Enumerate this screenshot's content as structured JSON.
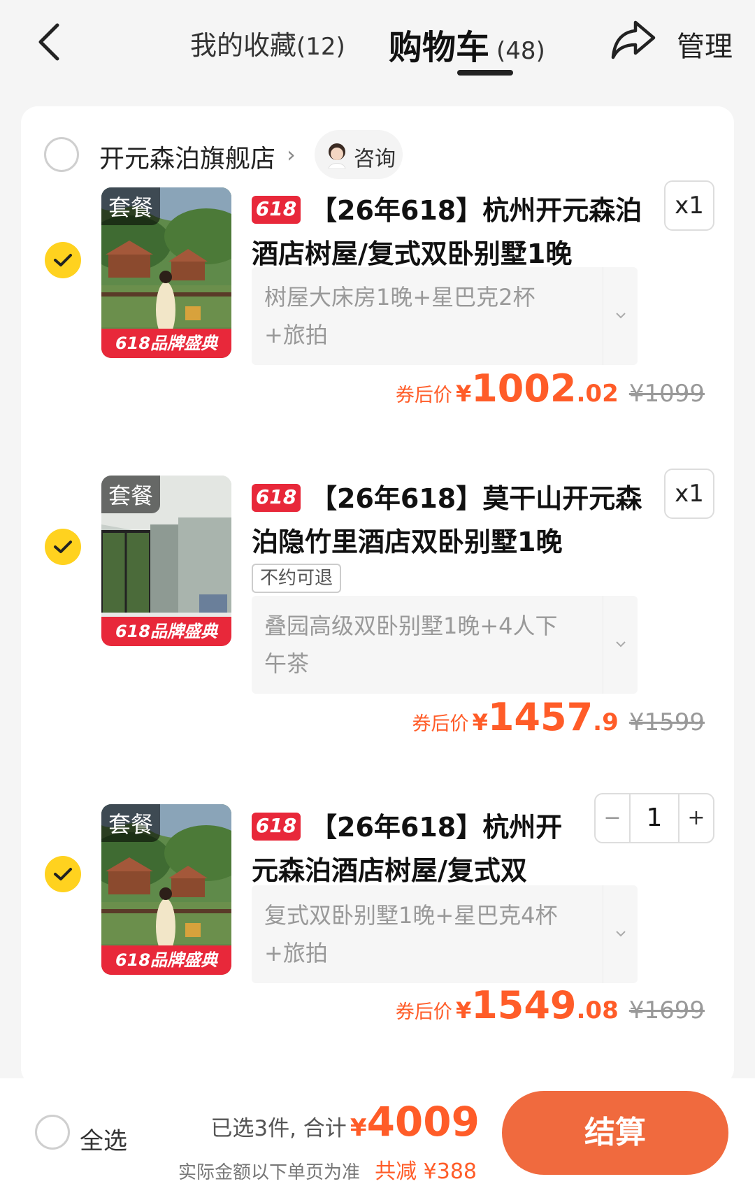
{
  "header": {
    "favorites_label": "我的收藏",
    "favorites_count": "(12)",
    "cart_label": "购物车",
    "cart_count": "(48)",
    "manage_label": "管理",
    "icons": [
      "chevron-left-icon",
      "share-icon"
    ]
  },
  "shop": {
    "name": "开元森泊旗舰店",
    "chevron": "›",
    "consult_label": "咨询"
  },
  "items": [
    {
      "thumb_tag": "套餐",
      "thumb_banner": "618品牌盛典",
      "badge": "618",
      "title": "【26年618】杭州开元森泊酒店树屋/复式双卧别墅1晚",
      "quantity": "x1",
      "spec": "树屋大床房1晚+星巴克2杯+旅拍",
      "price_label": "券后价",
      "currency": "¥",
      "price_int": "1002",
      "price_dec": ".02",
      "orig_price": "¥1099",
      "checked": true
    },
    {
      "thumb_tag": "套餐",
      "thumb_banner": "618品牌盛典",
      "badge": "618",
      "title": "【26年618】莫干山开元森泊隐竹里酒店双卧别墅1晚",
      "refund_tag": "不约可退",
      "quantity": "x1",
      "spec": "叠园高级双卧别墅1晚+4人下午茶",
      "price_label": "券后价",
      "currency": "¥",
      "price_int": "1457",
      "price_dec": ".9",
      "orig_price": "¥1599",
      "checked": true
    },
    {
      "thumb_tag": "套餐",
      "thumb_banner": "618品牌盛典",
      "badge": "618",
      "title": "【26年618】杭州开元森泊酒店树屋/复式双",
      "stepper": {
        "minus": "−",
        "value": "1",
        "plus": "+"
      },
      "spec": "复式双卧别墅1晚+星巴克4杯+旅拍",
      "price_label": "券后价",
      "currency": "¥",
      "price_int": "1549",
      "price_dec": ".08",
      "orig_price": "¥1699",
      "checked": true
    }
  ],
  "bottom": {
    "select_all": "全选",
    "selected_text": "已选3件, 合计",
    "currency": "¥",
    "total": "4009",
    "note": "实际金额以下单页为准",
    "saving": "共减 ¥388",
    "checkout": "结算"
  },
  "colors": {
    "accent_orange": "#ff5c28",
    "checkout_bg": "#f06a3e",
    "check_yellow": "#ffd21f",
    "badge_red": "#e8283a"
  }
}
